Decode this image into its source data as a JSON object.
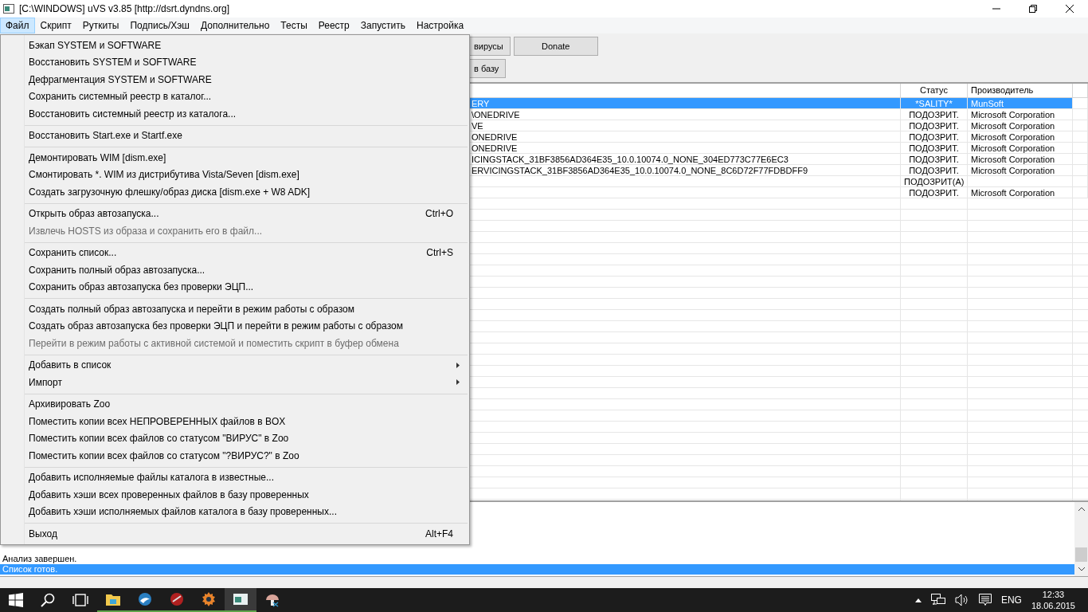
{
  "window": {
    "title": "[C:\\WINDOWS] uVS v3.85 [http://dsrt.dyndns.org]"
  },
  "menubar": [
    {
      "label": "Файл",
      "selected": true
    },
    {
      "label": "Скрипт",
      "selected": false
    },
    {
      "label": "Руткиты",
      "selected": false
    },
    {
      "label": "Подпись/Хэш",
      "selected": false
    },
    {
      "label": "Дополнительно",
      "selected": false
    },
    {
      "label": "Тесты",
      "selected": false
    },
    {
      "label": "Реестр",
      "selected": false
    },
    {
      "label": "Запустить",
      "selected": false
    },
    {
      "label": "Настройка",
      "selected": false
    }
  ],
  "toolbar": {
    "row_1": [
      "вирусы",
      "Donate"
    ],
    "row_2": [
      "в базу"
    ]
  },
  "file_menu": [
    [
      {
        "label": "Бэкап SYSTEM и SOFTWARE",
        "disabled": false
      },
      {
        "label": "Восстановить SYSTEM и SOFTWARE",
        "disabled": false
      },
      {
        "label": "Дефрагментация SYSTEM и SOFTWARE",
        "disabled": false
      },
      {
        "label": "Сохранить системный реестр в каталог...",
        "disabled": false
      },
      {
        "label": "Восстановить системный реестр из каталога...",
        "disabled": false
      }
    ],
    [
      {
        "label": "Восстановить Start.exe и Startf.exe",
        "disabled": false
      }
    ],
    [
      {
        "label": "Демонтировать  WIM [dism.exe]",
        "disabled": false
      },
      {
        "label": "Смонтировать *. WIM из дистрибутива Vista/Seven [dism.exe]",
        "disabled": false
      },
      {
        "label": "Создать загрузочную флешку/образ диска [dism.exe + W8 ADK]",
        "disabled": false
      }
    ],
    [
      {
        "label": "Открыть образ автозапуска...",
        "shortcut": "Ctrl+O",
        "disabled": false
      },
      {
        "label": "Извлечь HOSTS из образа и сохранить его в файл...",
        "disabled": true
      }
    ],
    [
      {
        "label": "Сохранить список...",
        "shortcut": "Ctrl+S",
        "disabled": false
      },
      {
        "label": "Сохранить полный образ автозапуска...",
        "disabled": false
      },
      {
        "label": "Сохранить образ автозапуска без проверки ЭЦП...",
        "disabled": false
      }
    ],
    [
      {
        "label": "Создать полный образ автозапуска и перейти в режим работы с образом",
        "disabled": false
      },
      {
        "label": "Создать образ автозапуска без проверки ЭЦП и перейти в режим работы с образом",
        "disabled": false
      },
      {
        "label": "Перейти в режим работы с активной системой и поместить скрипт в буфер обмена",
        "disabled": true
      }
    ],
    [
      {
        "label": "Добавить в список",
        "kind": "submenu",
        "disabled": false
      },
      {
        "label": "Импорт",
        "kind": "submenu",
        "disabled": false
      }
    ],
    [
      {
        "label": "Архивировать Zoo",
        "disabled": false
      },
      {
        "label": "Поместить копии всех НЕПРОВЕРЕННЫХ файлов в BOX",
        "disabled": false
      },
      {
        "label": "Поместить копии всех файлов со статусом \"ВИРУС\" в Zoo",
        "disabled": false
      },
      {
        "label": "Поместить копии всех файлов со статусом \"?ВИРУС?\" в Zoo",
        "disabled": false
      }
    ],
    [
      {
        "label": "Добавить исполняемые файлы каталога в известные...",
        "disabled": false
      },
      {
        "label": "Добавить хэши всех проверенных файлов в базу проверенных",
        "disabled": false
      },
      {
        "label": "Добавить хэши исполняемых файлов каталога в базу проверенных...",
        "disabled": false
      }
    ],
    [
      {
        "label": "Выход",
        "shortcut": "Alt+F4",
        "disabled": false
      }
    ]
  ],
  "table": {
    "columns": [
      "Статус",
      "Производитель"
    ],
    "rows": [
      {
        "column_1": "ERY",
        "status": "*SALITY*",
        "vendor": "MunSoft",
        "selected": true
      },
      {
        "column_1": "\\ONEDRIVE",
        "status": "ПОДОЗРИТ.",
        "vendor": "Microsoft Corporation",
        "selected": false
      },
      {
        "column_1": "VE",
        "status": "ПОДОЗРИТ.",
        "vendor": "Microsoft Corporation",
        "selected": false
      },
      {
        "column_1": "ONEDRIVE",
        "status": "ПОДОЗРИТ.",
        "vendor": "Microsoft Corporation",
        "selected": false
      },
      {
        "column_1": "ONEDRIVE",
        "status": "ПОДОЗРИТ.",
        "vendor": "Microsoft Corporation",
        "selected": false
      },
      {
        "column_1": "ICINGSTACK_31BF3856AD364E35_10.0.10074.0_NONE_304ED773C77E6EC3",
        "status": "ПОДОЗРИТ.",
        "vendor": "Microsoft Corporation",
        "selected": false
      },
      {
        "column_1": "ERVICINGSTACK_31BF3856AD364E35_10.0.10074.0_NONE_8C6D72F77FDBDFF9",
        "status": "ПОДОЗРИТ.",
        "vendor": "Microsoft Corporation",
        "selected": false
      },
      {
        "column_1": "",
        "status": "ПОДОЗРИТ(А)",
        "vendor": "",
        "selected": false
      },
      {
        "column_1": "",
        "status": "ПОДОЗРИТ.",
        "vendor": "Microsoft Corporation",
        "selected": false
      }
    ]
  },
  "log": [
    {
      "text": "Анализ завершен.",
      "selected": false
    },
    {
      "text": "Список готов.",
      "selected": true
    }
  ],
  "taskbar": {
    "language": "ENG",
    "time": "12:33",
    "date": "18.06.2015"
  }
}
